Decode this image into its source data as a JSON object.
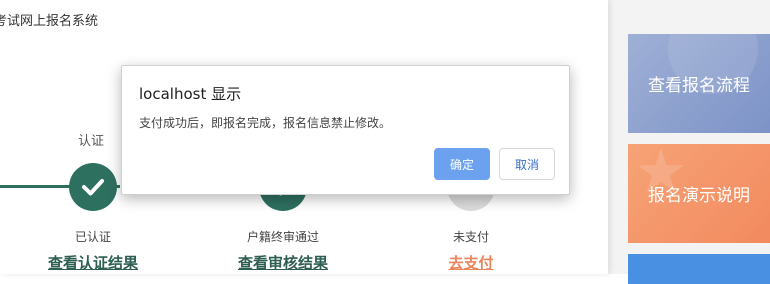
{
  "page": {
    "system_title": "考试网上报名系统"
  },
  "progress": {
    "top_label": "认证",
    "steps": [
      {
        "status": "已认证",
        "link": "查看认证结果",
        "icon": "check-icon"
      },
      {
        "status": "户籍终审通过",
        "link": "查看审核结果",
        "icon": "check-icon"
      },
      {
        "status": "未支付",
        "link": "去支付",
        "icon": "pending-circle"
      }
    ]
  },
  "sidebar": {
    "cards": [
      {
        "label": "查看报名流程"
      },
      {
        "label": "报名演示说明"
      },
      {
        "label": ""
      }
    ]
  },
  "dialog": {
    "title": "localhost 显示",
    "message": "支付成功后，即报名完成，报名信息禁止修改。",
    "ok_label": "确定",
    "cancel_label": "取消"
  },
  "colors": {
    "primary_green": "#2e7060",
    "pay_orange": "#e8845a",
    "card_blue": "#8ea3d0",
    "card_orange": "#f39a6c",
    "dialog_ok": "#6ba1ee"
  }
}
